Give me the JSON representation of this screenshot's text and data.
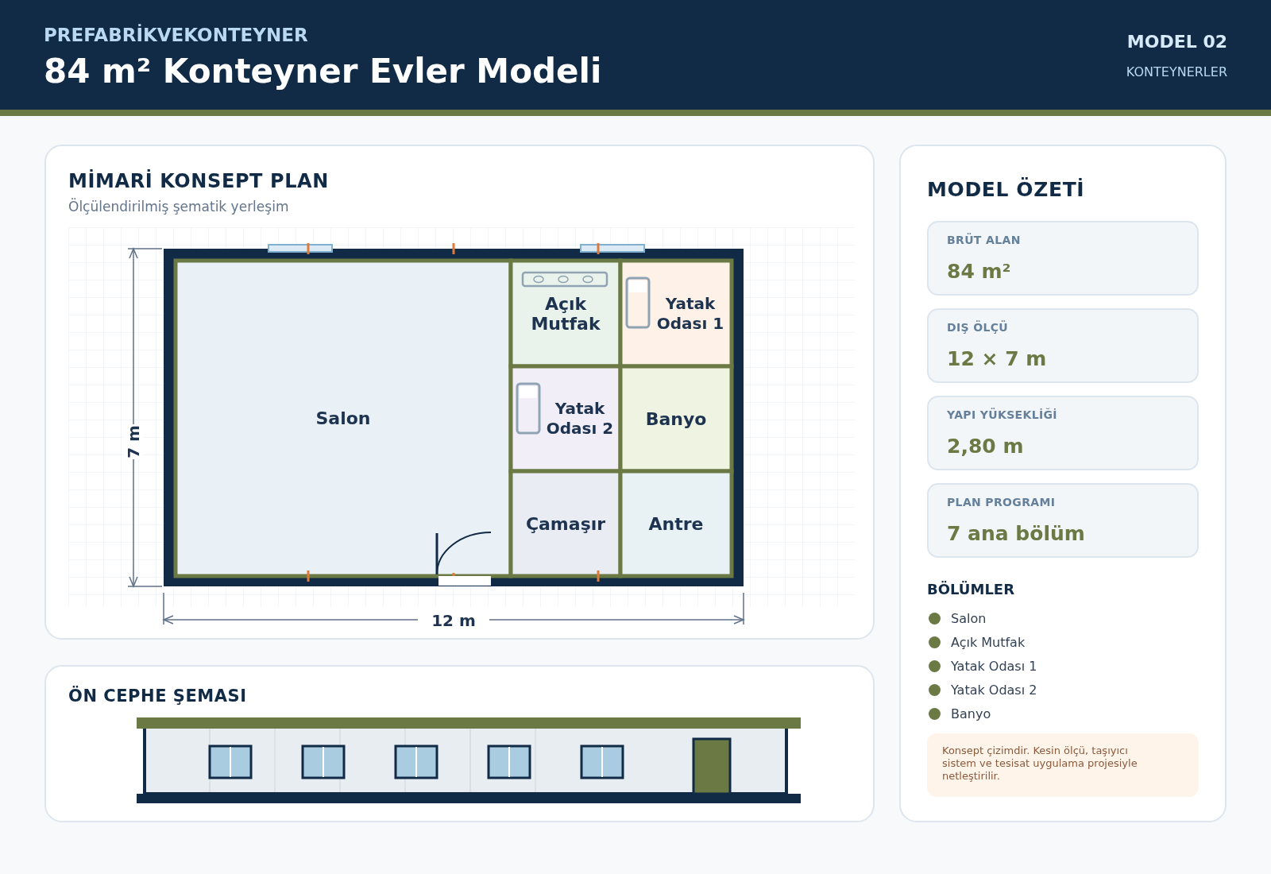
{
  "header": {
    "brand": "PREFABRİKVEKONTEYNER",
    "title": "84 m² Konteyner Evler Modeli",
    "model": "MODEL 02",
    "category": "KONTEYNERLER"
  },
  "plan": {
    "title": "MİMARİ KONSEPT PLAN",
    "subtitle": "Ölçülendirilmiş şematik yerleşim",
    "width_label": "12 m",
    "height_label": "7 m",
    "rooms": [
      {
        "label": "Salon",
        "color": "#e9f1f6",
        "kind": "plain"
      },
      {
        "label": "Açık Mutfak",
        "color": "#e9f3ec",
        "kind": "kitchen"
      },
      {
        "label": "Yatak Odası 2",
        "color": "#f1eef8",
        "kind": "bedroom"
      },
      {
        "label": "Çamaşır",
        "color": "#e9edf3",
        "kind": "plain"
      },
      {
        "label": "Yatak Odası 1",
        "color": "#fdf1e8",
        "kind": "bedroom"
      },
      {
        "label": "Banyo",
        "color": "#eff3e2",
        "kind": "plain"
      },
      {
        "label": "Antre",
        "color": "#e8f1f4",
        "kind": "plain"
      }
    ]
  },
  "facade": {
    "title": "ÖN CEPHE ŞEMASI"
  },
  "summary": {
    "title": "MODEL ÖZETİ",
    "stats": [
      {
        "label": "BRÜT ALAN",
        "value": "84 m²"
      },
      {
        "label": "DIŞ ÖLÇÜ",
        "value": "12 × 7 m"
      },
      {
        "label": "YAPI YÜKSEKLİĞİ",
        "value": "2,80 m"
      },
      {
        "label": "PLAN PROGRAMI",
        "value": "7 ana bölüm"
      }
    ],
    "sections_title": "BÖLÜMLER",
    "sections": [
      "Salon",
      "Açık Mutfak",
      "Yatak Odası 1",
      "Yatak Odası 2",
      "Banyo"
    ],
    "note": "Konsept çizimdir. Kesin ölçü, taşıyıcı sistem ve tesisat uygulama projesiyle netleştirilir."
  }
}
